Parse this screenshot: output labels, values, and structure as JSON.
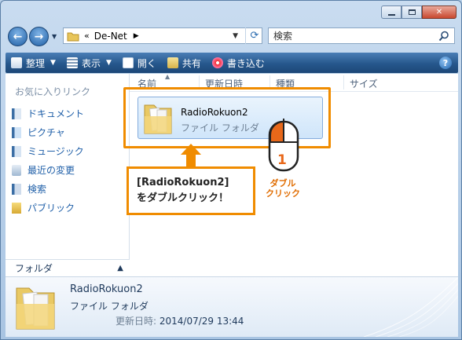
{
  "address": {
    "chevron": "«",
    "path": "De-Net"
  },
  "search": {
    "placeholder": "検索"
  },
  "toolbar": {
    "organize": "整理",
    "view": "表示",
    "open": "開く",
    "share": "共有",
    "burn": "書き込む"
  },
  "sidebar": {
    "title": "お気に入りリンク",
    "items": [
      {
        "label": "ドキュメント",
        "icon": "documents-icon"
      },
      {
        "label": "ピクチャ",
        "icon": "pictures-icon"
      },
      {
        "label": "ミュージック",
        "icon": "music-icon"
      },
      {
        "label": "最近の変更",
        "icon": "recent-icon"
      },
      {
        "label": "検索",
        "icon": "search-folder-icon"
      },
      {
        "label": "パブリック",
        "icon": "public-folder-icon"
      }
    ],
    "folders_label": "フォルダ"
  },
  "columns": [
    "名前",
    "更新日時",
    "種類",
    "サイズ"
  ],
  "selected_item": {
    "name": "RadioRokuon2",
    "type": "ファイル フォルダ"
  },
  "annotation": {
    "callout_line1": "[RadioRokuon2]",
    "callout_line2": "をダブルクリック！",
    "mouse_step": "1",
    "mouse_label_line1": "ダブル",
    "mouse_label_line2": "クリック"
  },
  "details": {
    "name": "RadioRokuon2",
    "type": "ファイル フォルダ",
    "modified_label": "更新日時:",
    "modified_value": "2014/07/29 13:44"
  },
  "colors": {
    "accent": "#f08c00",
    "toolbar": "#26578c"
  }
}
